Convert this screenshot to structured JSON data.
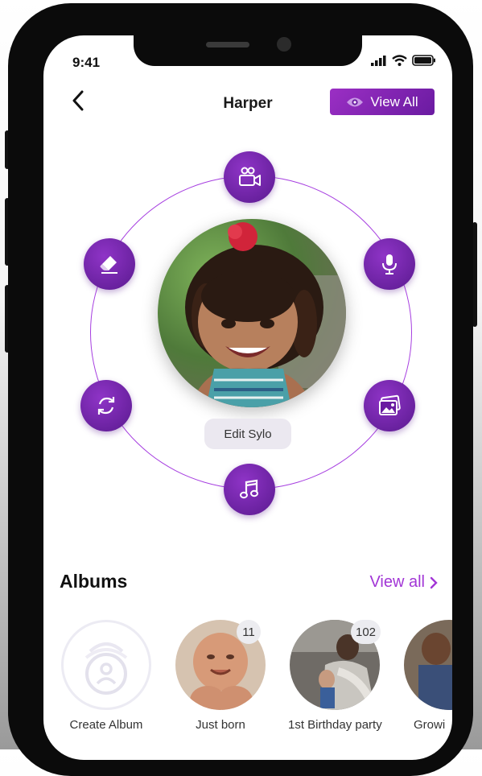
{
  "status_bar": {
    "time": "9:41"
  },
  "header": {
    "title": "Harper",
    "view_all_label": "View All"
  },
  "actions": [
    {
      "icon": "video-camera-icon"
    },
    {
      "icon": "microphone-icon"
    },
    {
      "icon": "photo-icon"
    },
    {
      "icon": "music-note-icon"
    },
    {
      "icon": "refresh-icon"
    },
    {
      "icon": "eraser-icon"
    }
  ],
  "edit_label": "Edit Sylo",
  "albums": {
    "title": "Albums",
    "view_all_label": "View all",
    "items": [
      {
        "label": "Create Album"
      },
      {
        "label": "Just born",
        "count": "11"
      },
      {
        "label": "1st Birthday party",
        "count": "102"
      },
      {
        "label": "Growi"
      }
    ]
  },
  "colors": {
    "accent": "#8a2bc2",
    "accent_dark": "#5a1a8f",
    "ring": "#a63ee0"
  }
}
